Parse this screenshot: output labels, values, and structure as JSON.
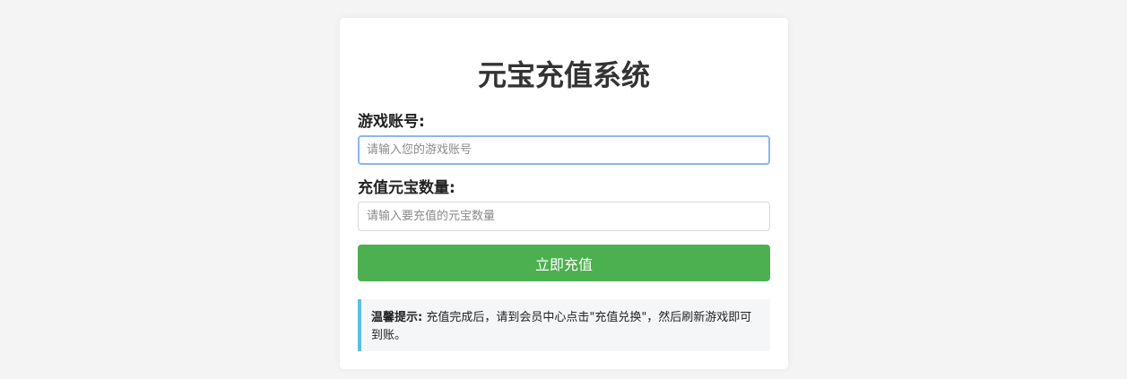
{
  "page": {
    "title": "元宝充值系统"
  },
  "form": {
    "account": {
      "label": "游戏账号:",
      "placeholder": "请输入您的游戏账号",
      "value": ""
    },
    "amount": {
      "label": "充值元宝数量:",
      "placeholder": "请输入要充值的元宝数量",
      "value": ""
    },
    "submit_label": "立即充值"
  },
  "notice": {
    "title": "温馨提示:",
    "text": "充值完成后，请到会员中心点击\"充值兑换\"，然后刷新游戏即可到账。"
  },
  "colors": {
    "page_background": "#f4f4f4",
    "button": "#4caf50",
    "notice_accent": "#5bc0de",
    "focus_border": "#8cb6f0"
  }
}
